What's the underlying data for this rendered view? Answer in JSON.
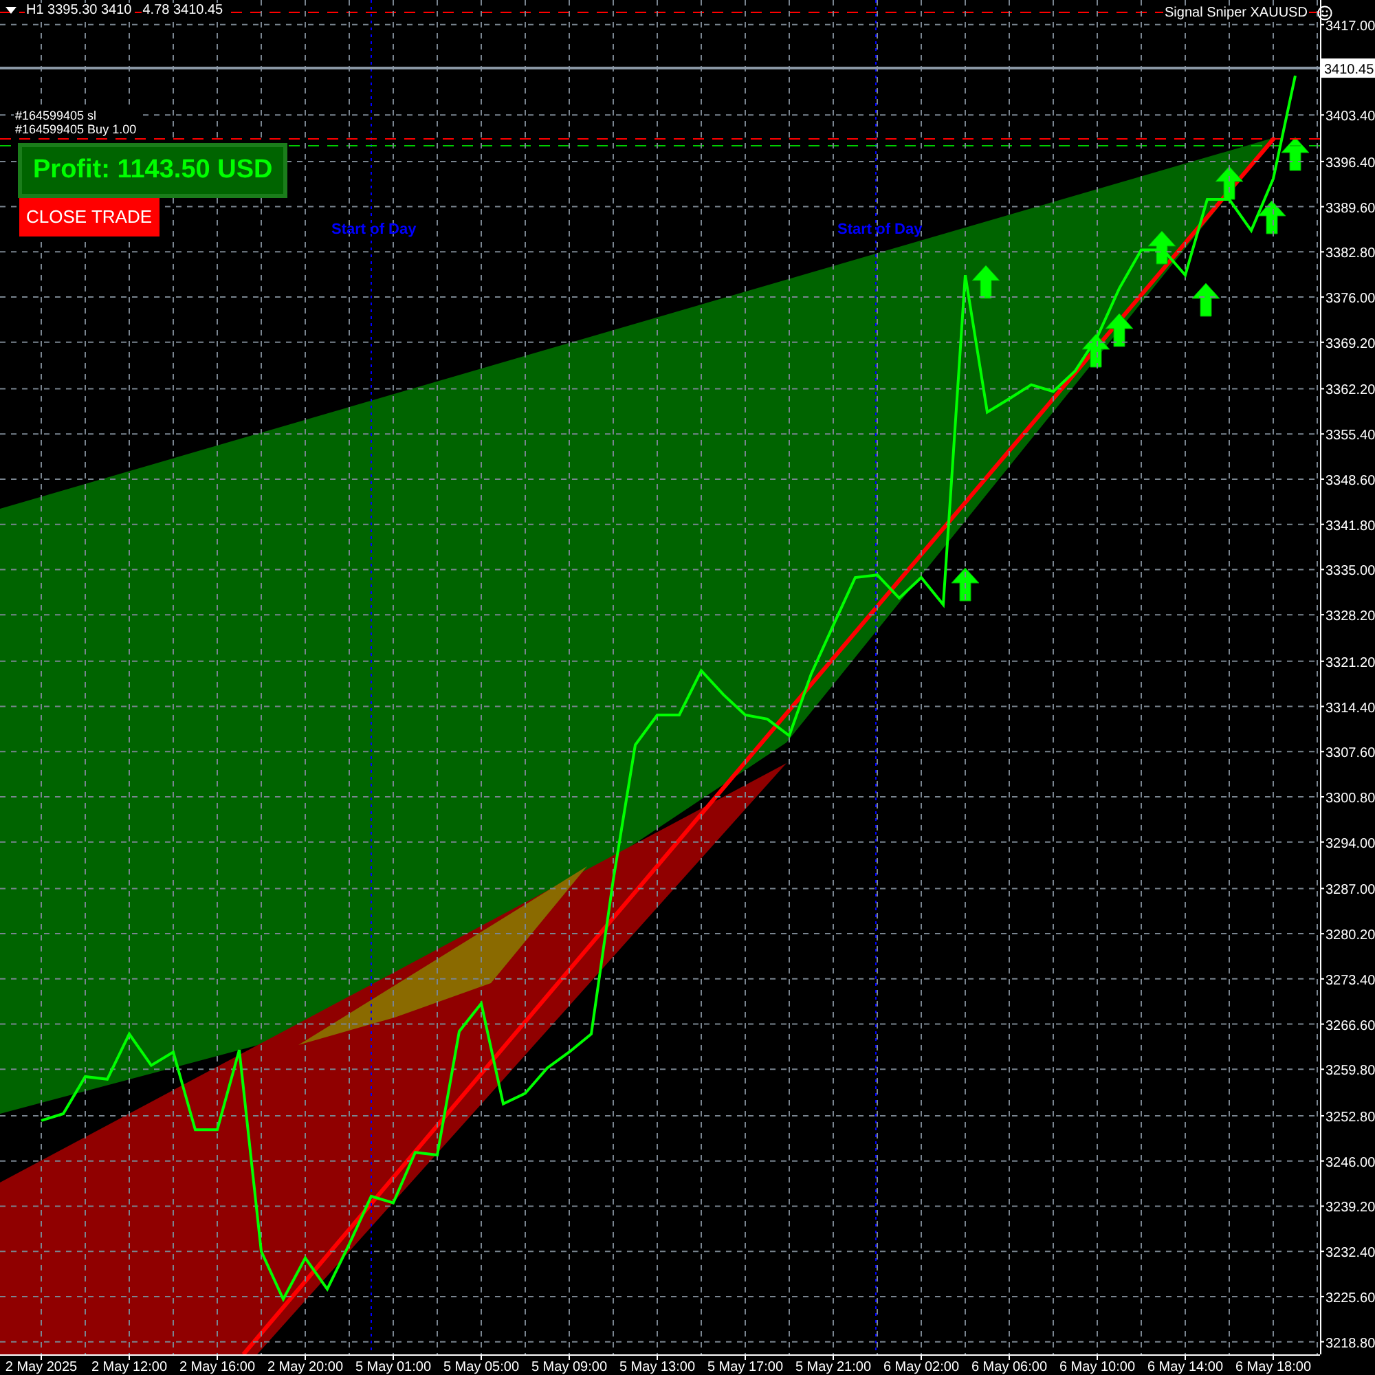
{
  "header": {
    "symbol_info": "H1 3395.30 3410",
    "quote": "4.78 3410.45"
  },
  "indicator_title": "Signal Sniper XAUUSD",
  "order_labels": [
    "#164599405 sl",
    "#164599405 Buy 1.00"
  ],
  "profit": "Profit: 1143.50 USD",
  "close_button": "CLOSE TRADE",
  "day_markers": [
    "Start of Day",
    "Start of Day"
  ],
  "chart_data": {
    "type": "line",
    "grid": true,
    "ylim": [
      3216.9,
      3420.7
    ],
    "categories": [
      "2 May 2025",
      null,
      null,
      null,
      "2 May 12:00",
      null,
      null,
      null,
      "2 May 16:00",
      null,
      null,
      null,
      "2 May 20:00",
      null,
      null,
      null,
      "5 May 01:00",
      null,
      null,
      null,
      "5 May 05:00",
      null,
      null,
      null,
      "5 May 09:00",
      null,
      null,
      null,
      "5 May 13:00",
      null,
      null,
      null,
      "5 May 17:00",
      null,
      null,
      null,
      "5 May 21:00",
      null,
      null,
      null,
      "6 May 02:00",
      null,
      null,
      null,
      "6 May 06:00",
      null,
      null,
      null,
      "6 May 10:00",
      null,
      null,
      null,
      "6 May 14:00",
      null,
      null,
      null,
      "6 May 18:00",
      null
    ],
    "ref_lines": [
      {
        "axis": "y",
        "value": 3410.45,
        "label": "3410.45"
      }
    ],
    "series": [
      {
        "color": "#00ff00",
        "values": [
          3252.1,
          3253.1,
          3258.7,
          3258.3,
          3265.1,
          3260.4,
          3262.4,
          3250.7,
          3250.7,
          3262.7,
          3232.4,
          3225.2,
          3231.4,
          3226.7,
          3233.5,
          3240.7,
          3239.7,
          3247.3,
          3246.9,
          3265.5,
          3269.7,
          3254.6,
          3256.2,
          3260.0,
          3262.4,
          3265.1,
          3288.3,
          3308.6,
          3313.1,
          3313.1,
          3319.8,
          3316.2,
          3313.1,
          3312.5,
          3310.0,
          3319.3,
          3326.6,
          3333.8,
          3334.2,
          3330.7,
          3333.8,
          3329.7,
          3379.3,
          3358.7,
          3360.7,
          3362.8,
          3361.8,
          3364.9,
          3370.0,
          3377.3,
          3383.1,
          3383.1,
          3379.3,
          3390.7,
          3390.7,
          3386.0,
          3393.8,
          3409.3
        ]
      }
    ],
    "yticks": [
      {
        "value": 3417.0,
        "label": "3417.00"
      },
      {
        "value": 3403.4,
        "label": "3403.40"
      },
      {
        "value": 3396.4,
        "label": "3396.40"
      },
      {
        "value": 3389.6,
        "label": "3389.60"
      },
      {
        "value": 3382.8,
        "label": "3382.80"
      },
      {
        "value": 3376.0,
        "label": "3376.00"
      },
      {
        "value": 3369.2,
        "label": "3369.20"
      },
      {
        "value": 3362.2,
        "label": "3362.20"
      },
      {
        "value": 3355.4,
        "label": "3355.40"
      },
      {
        "value": 3348.6,
        "label": "3348.60"
      },
      {
        "value": 3341.8,
        "label": "3341.80"
      },
      {
        "value": 3335.0,
        "label": "3335.00"
      },
      {
        "value": 3328.2,
        "label": "3328.20"
      },
      {
        "value": 3321.2,
        "label": "3321.20"
      },
      {
        "value": 3314.4,
        "label": "3314.40"
      },
      {
        "value": 3307.6,
        "label": "3307.60"
      },
      {
        "value": 3300.8,
        "label": "3300.80"
      },
      {
        "value": 3294.0,
        "label": "3294.00"
      },
      {
        "value": 3287.0,
        "label": "3287.00"
      },
      {
        "value": 3280.2,
        "label": "3280.20"
      },
      {
        "value": 3273.4,
        "label": "3273.40"
      },
      {
        "value": 3266.6,
        "label": "3266.60"
      },
      {
        "value": 3259.8,
        "label": "3259.80"
      },
      {
        "value": 3252.8,
        "label": "3252.80"
      },
      {
        "value": 3246.0,
        "label": "3246.00"
      },
      {
        "value": 3239.2,
        "label": "3239.20"
      },
      {
        "value": 3232.4,
        "label": "3232.40"
      },
      {
        "value": 3225.6,
        "label": "3225.60"
      },
      {
        "value": 3218.8,
        "label": "3218.80"
      }
    ]
  }
}
